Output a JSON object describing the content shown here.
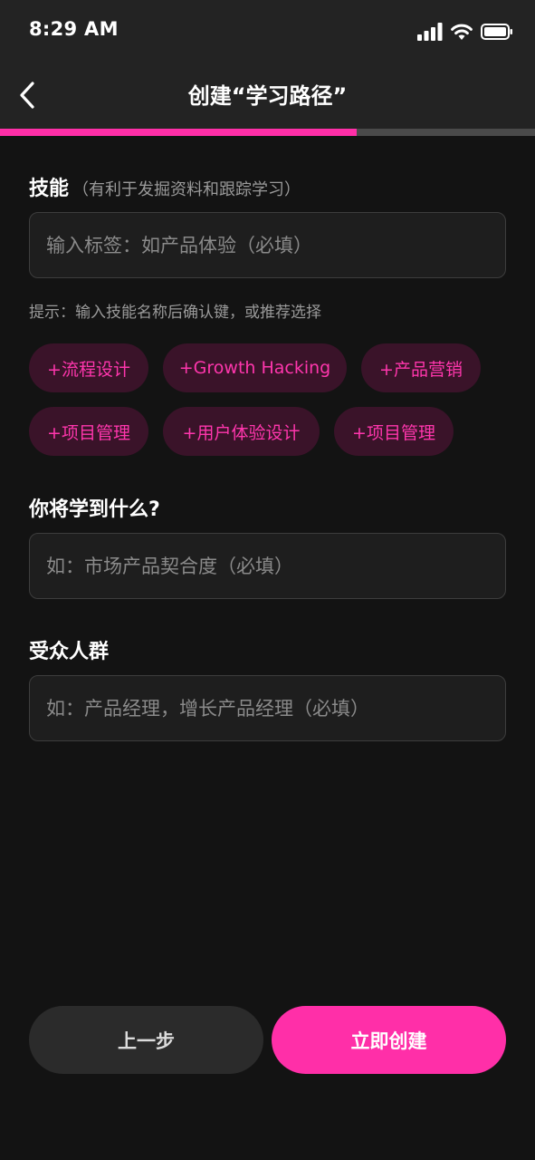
{
  "status_bar": {
    "time": "8:29 AM"
  },
  "nav": {
    "title": "创建“学习路径”"
  },
  "progress": {
    "fraction": 0.667
  },
  "skills": {
    "label": "技能",
    "sublabel": "（有利于发掘资料和跟踪学习）",
    "placeholder": "输入标签：如产品体验（必填）",
    "hint": "提示：输入技能名称后确认键，或推荐选择",
    "chips": [
      "+流程设计",
      "+Growth Hacking",
      "+产品营销",
      "+项目管理",
      "+用户体验设计",
      "+项目管理"
    ]
  },
  "learn": {
    "label": "你将学到什么?",
    "placeholder": "如：市场产品契合度（必填）"
  },
  "audience": {
    "label": "受众人群",
    "placeholder": "如：产品经理，增长产品经理（必填）"
  },
  "actions": {
    "prev_label": "上一步",
    "create_label": "立即创建"
  },
  "colors": {
    "accent": "#ff2fa8",
    "background": "#131313",
    "chip_bg": "#3a1329",
    "chip_text": "#ff36ad"
  },
  "icons": [
    "signal-icon",
    "wifi-icon",
    "battery-icon",
    "back-arrow-icon"
  ]
}
